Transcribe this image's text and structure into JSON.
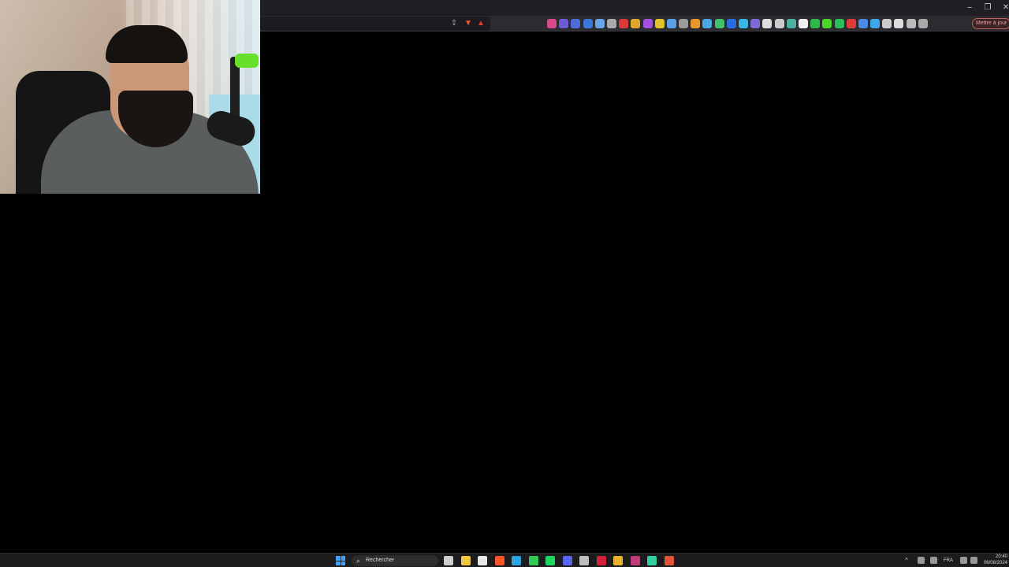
{
  "browser": {
    "window_controls": {
      "minimize": "–",
      "restore": "❐",
      "close": "✕"
    },
    "url_icons": {
      "share": "⇪",
      "shield": "▼",
      "rewards": "▲"
    },
    "extensions": [
      {
        "name": "ext-1",
        "color": "#d84a8c"
      },
      {
        "name": "ext-2",
        "color": "#6b5bd6"
      },
      {
        "name": "ext-3",
        "color": "#4e6bd8"
      },
      {
        "name": "ext-4",
        "color": "#3b77d6"
      },
      {
        "name": "ext-5",
        "color": "#6aa3e6"
      },
      {
        "name": "ext-6",
        "color": "#aaaaaa"
      },
      {
        "name": "ext-7",
        "color": "#d83a3a"
      },
      {
        "name": "ext-8",
        "color": "#e0a52b"
      },
      {
        "name": "ext-9",
        "color": "#a34fe0"
      },
      {
        "name": "ext-10",
        "color": "#e0c22b"
      },
      {
        "name": "ext-11",
        "color": "#5aa0e8"
      },
      {
        "name": "ext-12",
        "color": "#9a9a9a"
      },
      {
        "name": "ext-13",
        "color": "#e8962b"
      },
      {
        "name": "ext-14",
        "color": "#4aa8e0"
      },
      {
        "name": "ext-15",
        "color": "#43c06b"
      },
      {
        "name": "ext-16",
        "color": "#2b6be0"
      },
      {
        "name": "ext-17",
        "color": "#3ab5e6"
      },
      {
        "name": "ext-18",
        "color": "#7a6bd6"
      },
      {
        "name": "ext-19",
        "color": "#dddddd"
      },
      {
        "name": "ext-20",
        "color": "#cccccc"
      },
      {
        "name": "ext-21",
        "color": "#4ab0a0"
      },
      {
        "name": "ext-22",
        "color": "#eeeeee"
      },
      {
        "name": "ext-23",
        "color": "#2fb84a"
      },
      {
        "name": "ext-24",
        "color": "#4ad62b"
      },
      {
        "name": "ext-25",
        "color": "#2bbd5a"
      },
      {
        "name": "ext-26",
        "color": "#e03a3a"
      },
      {
        "name": "ext-27",
        "color": "#4b8be8"
      },
      {
        "name": "ext-28",
        "color": "#3aa8e8"
      },
      {
        "name": "ext-29",
        "color": "#cccccc"
      },
      {
        "name": "ext-30",
        "color": "#dddddd"
      },
      {
        "name": "ext-31",
        "color": "#bbbbbb"
      },
      {
        "name": "ext-32",
        "color": "#aaaaaa"
      }
    ],
    "toolbar_icons": [
      "music-icon",
      "sidebar-icon",
      "tabs-icon",
      "wallet-icon",
      "vpn-icon"
    ],
    "update_button": "Mettre à jour"
  },
  "taskbar": {
    "search_icon": "⌕",
    "search_placeholder": "Rechercher",
    "apps": [
      {
        "name": "task-view",
        "color": "#cfcfcf"
      },
      {
        "name": "file-explorer",
        "color": "#f2c744"
      },
      {
        "name": "store",
        "color": "#e8e8e8"
      },
      {
        "name": "brave",
        "color": "#fb542b"
      },
      {
        "name": "telegram",
        "color": "#2aa3e0"
      },
      {
        "name": "whatsapp",
        "color": "#2ecc55"
      },
      {
        "name": "spotify",
        "color": "#1ed760"
      },
      {
        "name": "discord",
        "color": "#5865f2"
      },
      {
        "name": "obs",
        "color": "#bfbfbf"
      },
      {
        "name": "opera",
        "color": "#d6213a"
      },
      {
        "name": "chrome",
        "color": "#e8b22b"
      },
      {
        "name": "editor",
        "color": "#c23a7a"
      },
      {
        "name": "app-green",
        "color": "#2fcfa0"
      },
      {
        "name": "app-red",
        "color": "#e0553a"
      }
    ],
    "tray": {
      "chevron": "^",
      "language": "FRA"
    },
    "clock": {
      "time": "20:40",
      "date": "06/08/2024"
    }
  }
}
